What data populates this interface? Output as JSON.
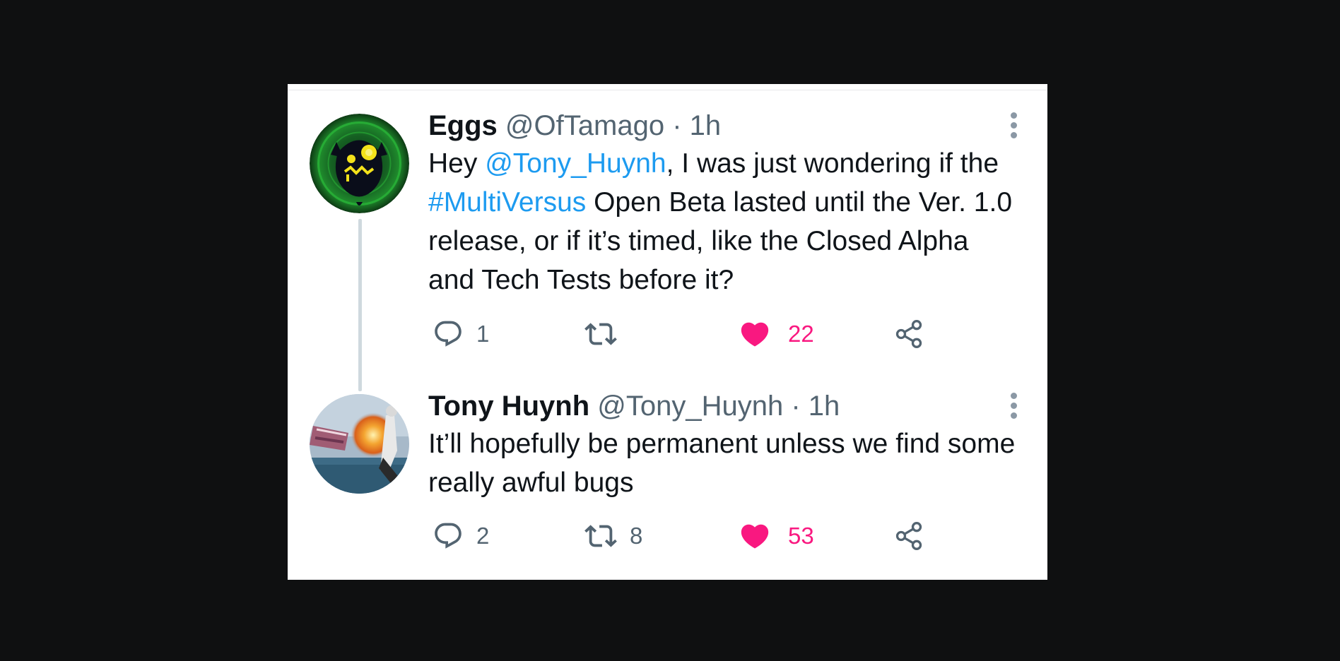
{
  "tweets": [
    {
      "name": "Eggs",
      "handle": "@OfTamago",
      "time": "· 1h",
      "text_before": "Hey ",
      "mention": "@Tony_Huynh",
      "text_middle": ", I was just wondering if the ",
      "hashtag": "#MultiVersus",
      "text_after": " Open Beta lasted until the Ver. 1.0 release, or if it’s timed, like the Closed Alpha and Tech Tests before it?",
      "replies": "1",
      "retweets": "",
      "likes": "22",
      "avatar": "avatar-green-creature"
    },
    {
      "name": "Tony Huynh",
      "handle": "@Tony_Huynh",
      "time": "· 1h",
      "text": "It’ll hopefully be permanent unless we find some really awful bugs",
      "replies": "2",
      "retweets": "8",
      "likes": "53",
      "avatar": "avatar-explosion-scene"
    }
  ],
  "colors": {
    "background": "#0f1011",
    "card": "#ffffff",
    "link": "#1d9bf0",
    "like": "#f91880",
    "muted": "#536471",
    "text": "#0f1419"
  },
  "icons": [
    "reply-icon",
    "retweet-icon",
    "like-icon",
    "share-icon",
    "more-options-icon"
  ]
}
